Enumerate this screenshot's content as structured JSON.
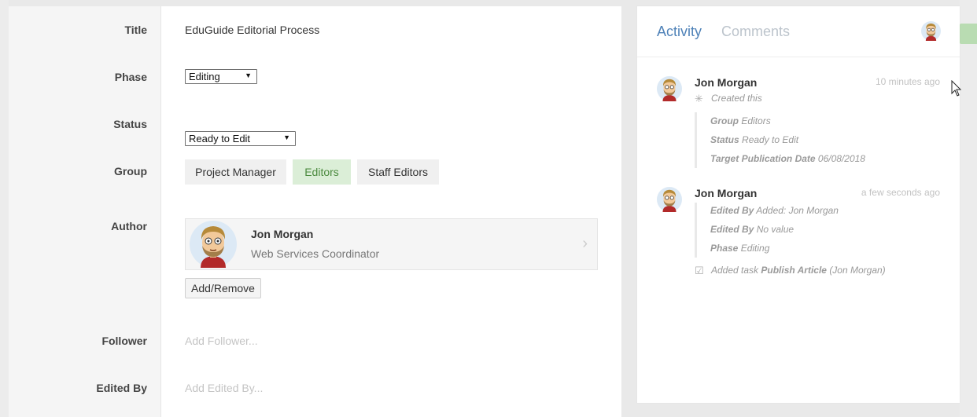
{
  "form": {
    "title": {
      "label": "Title",
      "value": "EduGuide Editorial Process"
    },
    "phase": {
      "label": "Phase",
      "value": "Editing"
    },
    "status": {
      "label": "Status",
      "value": "Ready to Edit"
    },
    "group": {
      "label": "Group",
      "options": [
        {
          "label": "Project Manager",
          "selected": false
        },
        {
          "label": "Editors",
          "selected": true
        },
        {
          "label": "Staff Editors",
          "selected": false
        }
      ]
    },
    "author": {
      "label": "Author",
      "name": "Jon Morgan",
      "role": "Web Services Coordinator",
      "add_remove_label": "Add/Remove"
    },
    "follower": {
      "label": "Follower",
      "placeholder": "Add Follower..."
    },
    "edited_by": {
      "label": "Edited By",
      "placeholder": "Add Edited By..."
    }
  },
  "activity": {
    "tabs": [
      {
        "label": "Activity",
        "active": true
      },
      {
        "label": "Comments",
        "active": false
      }
    ],
    "entries": [
      {
        "user": "Jon Morgan",
        "time": "10 minutes ago",
        "action": "Created this",
        "details": [
          {
            "key": "Group",
            "value": "Editors"
          },
          {
            "key": "Status",
            "value": "Ready to Edit"
          },
          {
            "key": "Target Publication Date",
            "value": "06/08/2018"
          }
        ]
      },
      {
        "user": "Jon Morgan",
        "time": "a few seconds ago",
        "details": [
          {
            "key": "Edited By",
            "value": "Added: Jon Morgan"
          },
          {
            "key": "Edited By",
            "value": "No value"
          },
          {
            "key": "Phase",
            "value": "Editing"
          }
        ],
        "task": {
          "prefix": "Added task",
          "name": "Publish Article",
          "suffix": "(Jon Morgan)"
        }
      }
    ]
  },
  "colors": {
    "accent": "#4f82b8",
    "selected_group_bg": "#dbeed7",
    "selected_group_text": "#4b8a3e"
  },
  "icons": {
    "created": "sparkle-icon",
    "task": "checkbox-icon",
    "chevron": "chevron-right-icon"
  }
}
